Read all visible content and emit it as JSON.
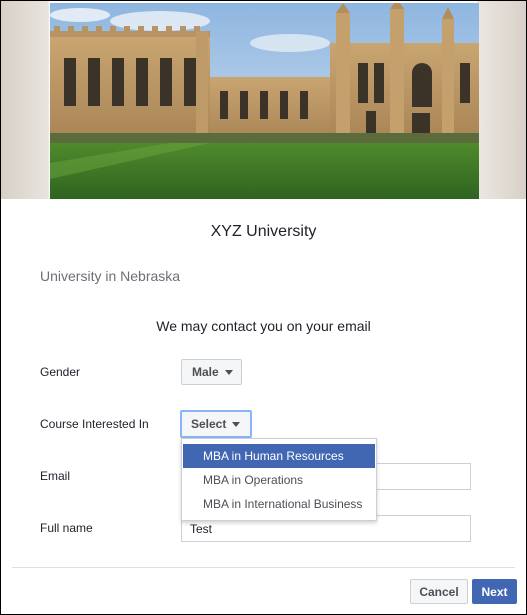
{
  "header": {
    "image_alt": "university building",
    "title": "XYZ University",
    "subtitle": "University in Nebraska"
  },
  "form": {
    "notice": "We may contact you on your email",
    "gender": {
      "label": "Gender",
      "value": "Male"
    },
    "course": {
      "label": "Course Interested In",
      "value": "Select",
      "options": [
        "MBA in Human Resources",
        "MBA in Operations",
        "MBA in International Business"
      ],
      "highlighted_option": "MBA in Human Resources"
    },
    "email": {
      "label": "Email",
      "value": ""
    },
    "full_name": {
      "label": "Full name",
      "value": "Test"
    }
  },
  "footer": {
    "cancel_label": "Cancel",
    "next_label": "Next"
  },
  "colors": {
    "accent": "#4267b2",
    "focus": "#8ab4f8",
    "border": "#ccd0d5"
  }
}
